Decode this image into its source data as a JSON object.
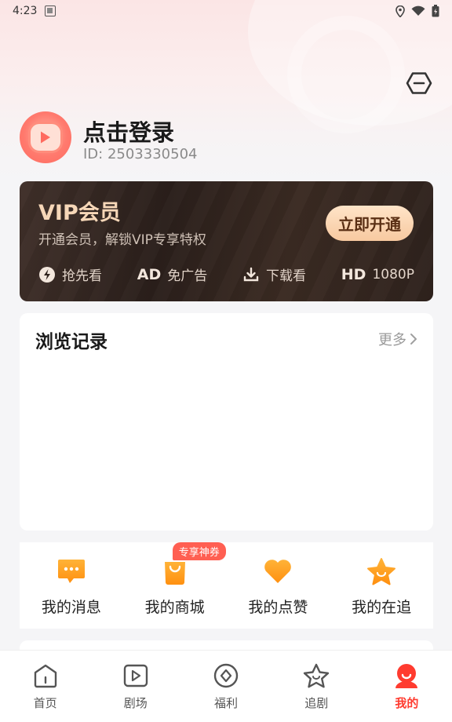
{
  "status_bar": {
    "time": "4:23"
  },
  "user": {
    "login_title": "点击登录",
    "id_text": "ID: 2503330504"
  },
  "vip": {
    "title": "VIP会员",
    "subtitle": "开通会员，解锁VIP专享特权",
    "button_label": "立即开通",
    "perks": [
      {
        "icon": "lightning-icon",
        "label": "抢先看"
      },
      {
        "icon_text": "AD",
        "label": "免广告"
      },
      {
        "icon": "download-icon",
        "label": "下载看"
      },
      {
        "icon_text": "HD",
        "label": "1080P"
      }
    ],
    "colors": {
      "title": "#f6d7b8",
      "button_bg": "#f7c9a0",
      "card_bg": "#2a1f1b"
    }
  },
  "history": {
    "title": "浏览记录",
    "more_label": "更多"
  },
  "menu": {
    "items": [
      {
        "icon": "message-icon",
        "label": "我的消息"
      },
      {
        "icon": "shopping-bag-icon",
        "label": "我的商城",
        "badge": "专享神券"
      },
      {
        "icon": "heart-icon",
        "label": "我的点赞"
      },
      {
        "icon": "star-icon",
        "label": "我的在追"
      }
    ]
  },
  "bottom_nav": {
    "items": [
      {
        "icon": "home-icon",
        "label": "首页"
      },
      {
        "icon": "play-square-icon",
        "label": "剧场"
      },
      {
        "icon": "coin-icon",
        "label": "福利"
      },
      {
        "icon": "star-outline-icon",
        "label": "追剧"
      },
      {
        "icon": "profile-icon",
        "label": "我的",
        "active": true
      }
    ],
    "active_color": "#ff3b2f"
  }
}
